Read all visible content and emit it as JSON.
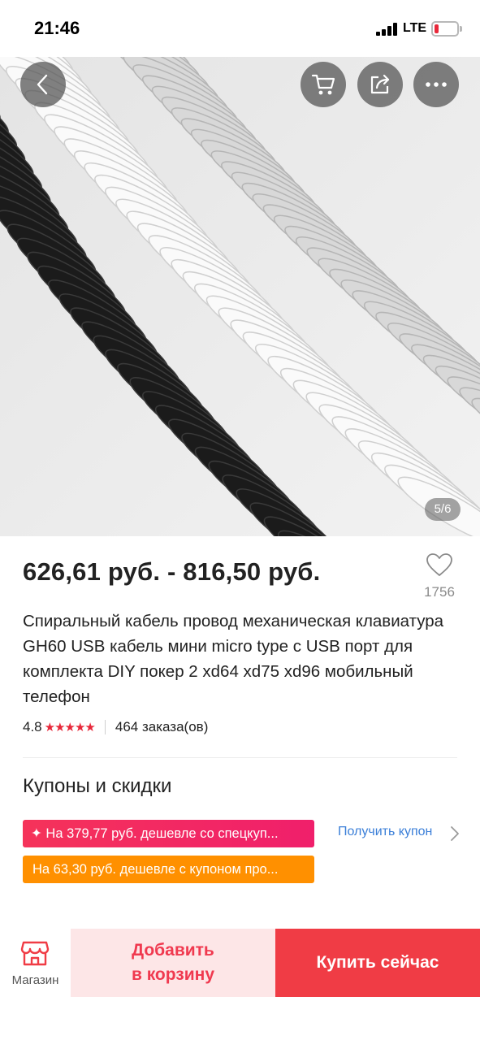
{
  "status_bar": {
    "time": "21:46",
    "network": "LTE",
    "battery_level": 0.18,
    "battery_color": "#e8283a"
  },
  "gallery": {
    "image_counter": "5/6",
    "buttons": [
      "back-icon",
      "cart-icon",
      "share-icon",
      "more-icon"
    ]
  },
  "product": {
    "price": "626,61 руб. - 816,50 руб.",
    "wishlist_count": "1756",
    "title": "Спиральный кабель провод механическая клавиатура GH60 USB кабель мини micro type c USB порт для комплекта DIY покер 2 xd64 xd75 xd96 мобильный телефон",
    "rating": "4.8",
    "stars": "★★★★★",
    "orders": "464 заказа(ов)"
  },
  "coupons": {
    "section_title": "Купоны и скидки",
    "items": [
      "✦ На 379,77 руб. дешевле со спецкуп...",
      "На 63,30 руб. дешевле с купоном про..."
    ],
    "get_coupon_label": "Получить купон",
    "colors": {
      "special": "#f0245f",
      "promo": "#ff9000",
      "link": "#3b7fd8"
    }
  },
  "bottom_bar": {
    "store_label": "Магазин",
    "add_to_cart_line1": "Добавить",
    "add_to_cart_line2": "в корзину",
    "buy_now_label": "Купить сейчас",
    "accent_color": "#f03c45"
  }
}
